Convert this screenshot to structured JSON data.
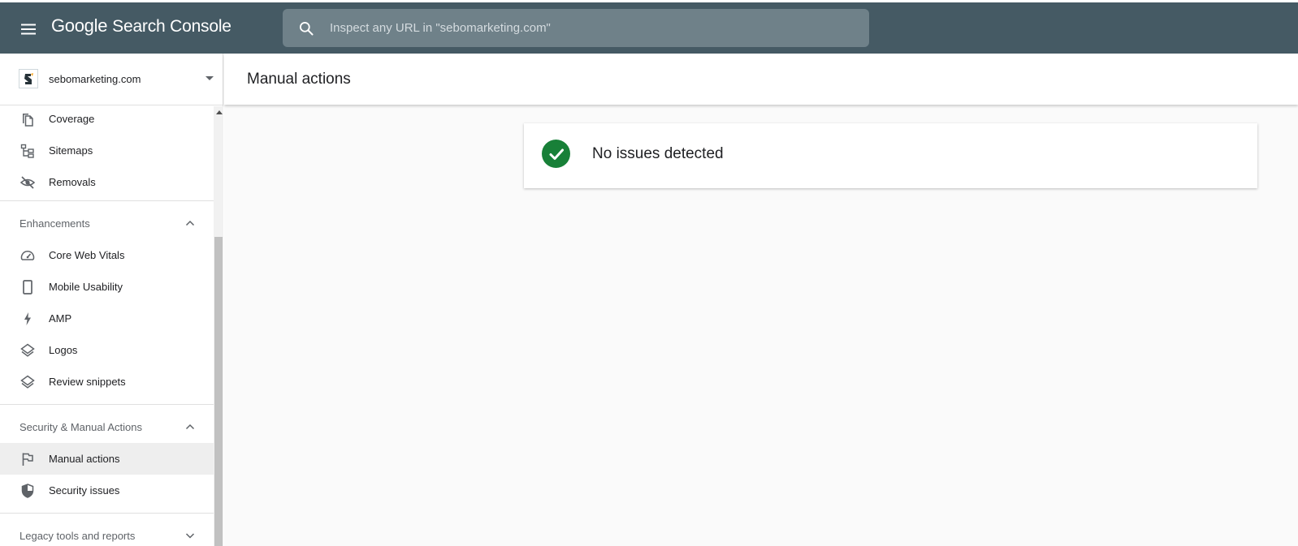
{
  "topbar": {
    "brand_google": "Google",
    "brand_product": "Search Console",
    "search_placeholder": "Inspect any URL in \"sebomarketing.com\""
  },
  "property": {
    "name": "sebomarketing.com"
  },
  "sidebar": {
    "items_top": [
      {
        "label": "Coverage",
        "icon": "coverage-icon"
      },
      {
        "label": "Sitemaps",
        "icon": "sitemaps-icon"
      },
      {
        "label": "Removals",
        "icon": "removals-icon"
      }
    ],
    "enhancements": {
      "title": "Enhancements",
      "items": [
        {
          "label": "Core Web Vitals",
          "icon": "speedometer-icon"
        },
        {
          "label": "Mobile Usability",
          "icon": "phone-icon"
        },
        {
          "label": "AMP",
          "icon": "lightning-icon"
        },
        {
          "label": "Logos",
          "icon": "layers-icon"
        },
        {
          "label": "Review snippets",
          "icon": "layers-icon"
        }
      ]
    },
    "security": {
      "title": "Security & Manual Actions",
      "items": [
        {
          "label": "Manual actions",
          "icon": "flag-icon",
          "active": true
        },
        {
          "label": "Security issues",
          "icon": "shield-icon"
        }
      ]
    },
    "legacy": {
      "title": "Legacy tools and reports"
    }
  },
  "main": {
    "title": "Manual actions",
    "status_text": "No issues detected"
  },
  "colors": {
    "topbar": "#455a64",
    "success": "#188038",
    "active_item": "#eeeeee"
  }
}
